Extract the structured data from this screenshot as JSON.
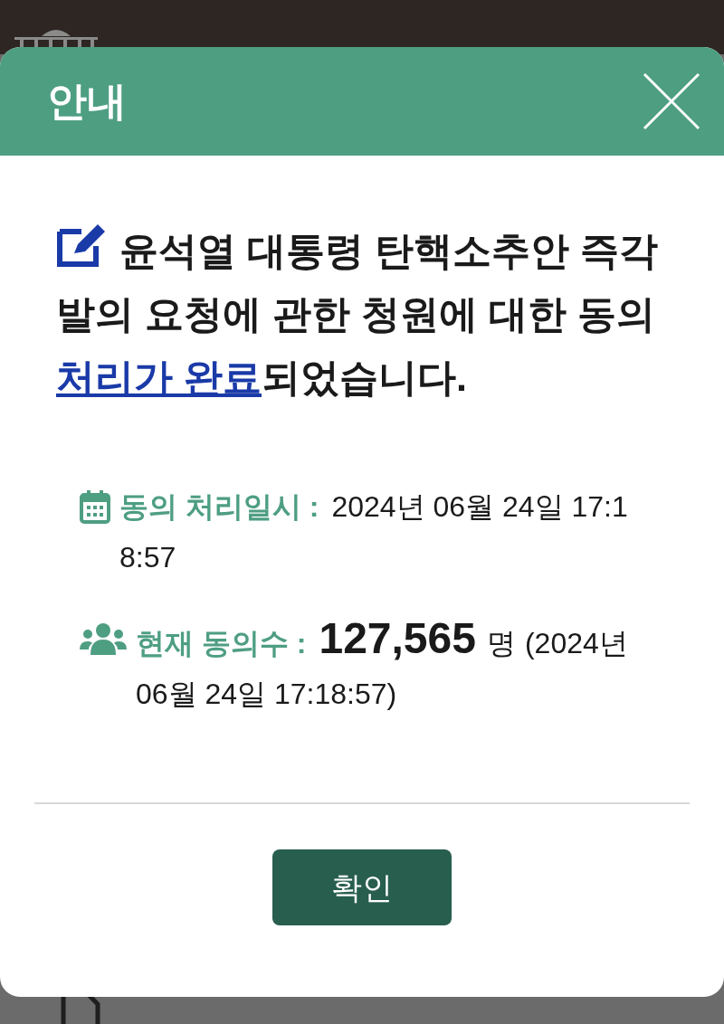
{
  "dialog": {
    "title": "안내",
    "message": {
      "before": "윤석열 대통령 탄핵소추안 즉각 발의 요청에 관한 청원에 대한 동의 ",
      "link": "처리가 완료",
      "after": "되었습니다."
    },
    "details": [
      {
        "kind": "date",
        "label": "동의 처리일시 :",
        "value": "2024년 06월 24일 17:18:57"
      },
      {
        "kind": "count",
        "label": "현재 동의수 :",
        "count": "127,565",
        "unit": "명",
        "value": "(2024년 06월 24일 17:18:57)"
      }
    ],
    "confirm_button": "확인"
  }
}
